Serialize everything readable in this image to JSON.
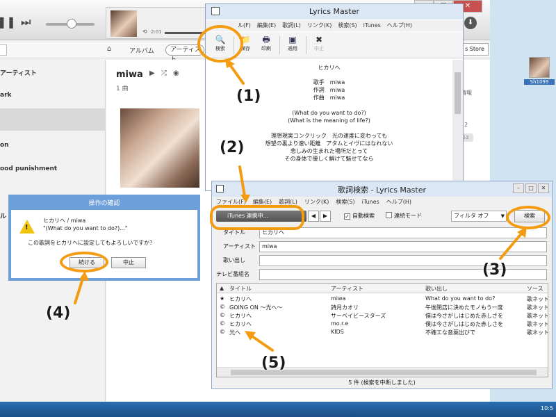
{
  "lyrics_master": {
    "title": "Lyrics Master",
    "menu": [
      "ル(F)",
      "編集(E)",
      "歌詞(L)",
      "リンク(K)",
      "検索(S)",
      "iTunes",
      "ヘルプ(H)"
    ],
    "toolbar": {
      "search": "検索",
      "save": "保存",
      "print": "印刷",
      "apply": "適用",
      "stop": "中止"
    },
    "lyrics": {
      "title": "ヒカリヘ",
      "singer": "歌手　miwa",
      "lyricist": "作詞　miwa",
      "composer": "作曲　miwa",
      "lines": [
        "(What do you want to do?)",
        "(What is the meaning of life?)",
        "",
        "理想現実コンクリック　光の速度に変わっても",
        "想望の裏より速い距離　アタムとイヴにはなれない",
        "悲しみの生まれた場所だとって",
        "その身体で優しく解けて魅せてなら"
      ]
    }
  },
  "search_dialog": {
    "title": "歌詞検索 - Lyrics Master",
    "menu": [
      "ファイル(F)",
      "編集(E)",
      "歌詞(L)",
      "リンク(K)",
      "検索(S)",
      "iTunes",
      "ヘルプ(H)"
    ],
    "itunes_button": "iTunes 連携中...",
    "auto_search_label": "自動検索",
    "continuous_mode_label": "連続モード",
    "filter_value": "フィルタ オフ",
    "search_button": "検索",
    "fields": {
      "title_label": "タイトル",
      "title_value": "ヒカリヘ",
      "artist_label": "アーティスト",
      "artist_value": "miwa",
      "opening_label": "歌い出し",
      "opening_value": "",
      "tv_label": "テレビ番組名",
      "tv_value": ""
    },
    "columns": [
      "タイトル",
      "アーティスト",
      "歌い出し",
      "ソース"
    ],
    "rows": [
      {
        "mark": "★",
        "title": "ヒカリヘ",
        "artist": "miwa",
        "opening": "What do you want to do?",
        "source": "歌ネット"
      },
      {
        "mark": "©",
        "title": "GOING ON ～光へ～",
        "artist": "詩月カオリ",
        "opening": "午後閉店に決めたモノもう一度",
        "source": "歌ネット"
      },
      {
        "mark": "©",
        "title": "ヒカリへ",
        "artist": "サーベイビースターズ",
        "opening": "僕は今さがしはじめた赤しさを",
        "source": "歌ネット"
      },
      {
        "mark": "©",
        "title": "ヒカリヘ",
        "artist": "mo.r.e",
        "opening": "僕は今さがしはじめた赤しさを",
        "source": "歌ネット"
      },
      {
        "mark": "©",
        "title": "光へ",
        "artist": "KIDS",
        "opening": "不確エな音葉出びで",
        "source": "歌ネット"
      }
    ],
    "status": "5 件 (検索を中断しました)"
  },
  "confirm_dialog": {
    "title": "操作の確認",
    "line1": "ヒカリヘ / miwa",
    "line2": "\"(What do you want to do?)...\"",
    "line3": "この歌詞をヒカリヘに設定してもよろしいですか？",
    "continue_button": "続ける",
    "cancel_button": "中止"
  },
  "itunes": {
    "time": "2:01",
    "album_tab": "アルバム",
    "artist_tab": "アーティスト",
    "store_button": "s Store",
    "sidebar": [
      "アーティスト",
      "ark",
      "on",
      "ood punishment",
      "ル"
    ],
    "artist_name": "miwa",
    "song_count": "1 曲",
    "side_info": [
      "情報",
      "12",
      "53"
    ]
  },
  "desktop": {
    "icon_label": "Sh1099",
    "clock": "10:5"
  },
  "annotations": [
    "(1)",
    "(2)",
    "(3)",
    "(4)",
    "(5)"
  ]
}
